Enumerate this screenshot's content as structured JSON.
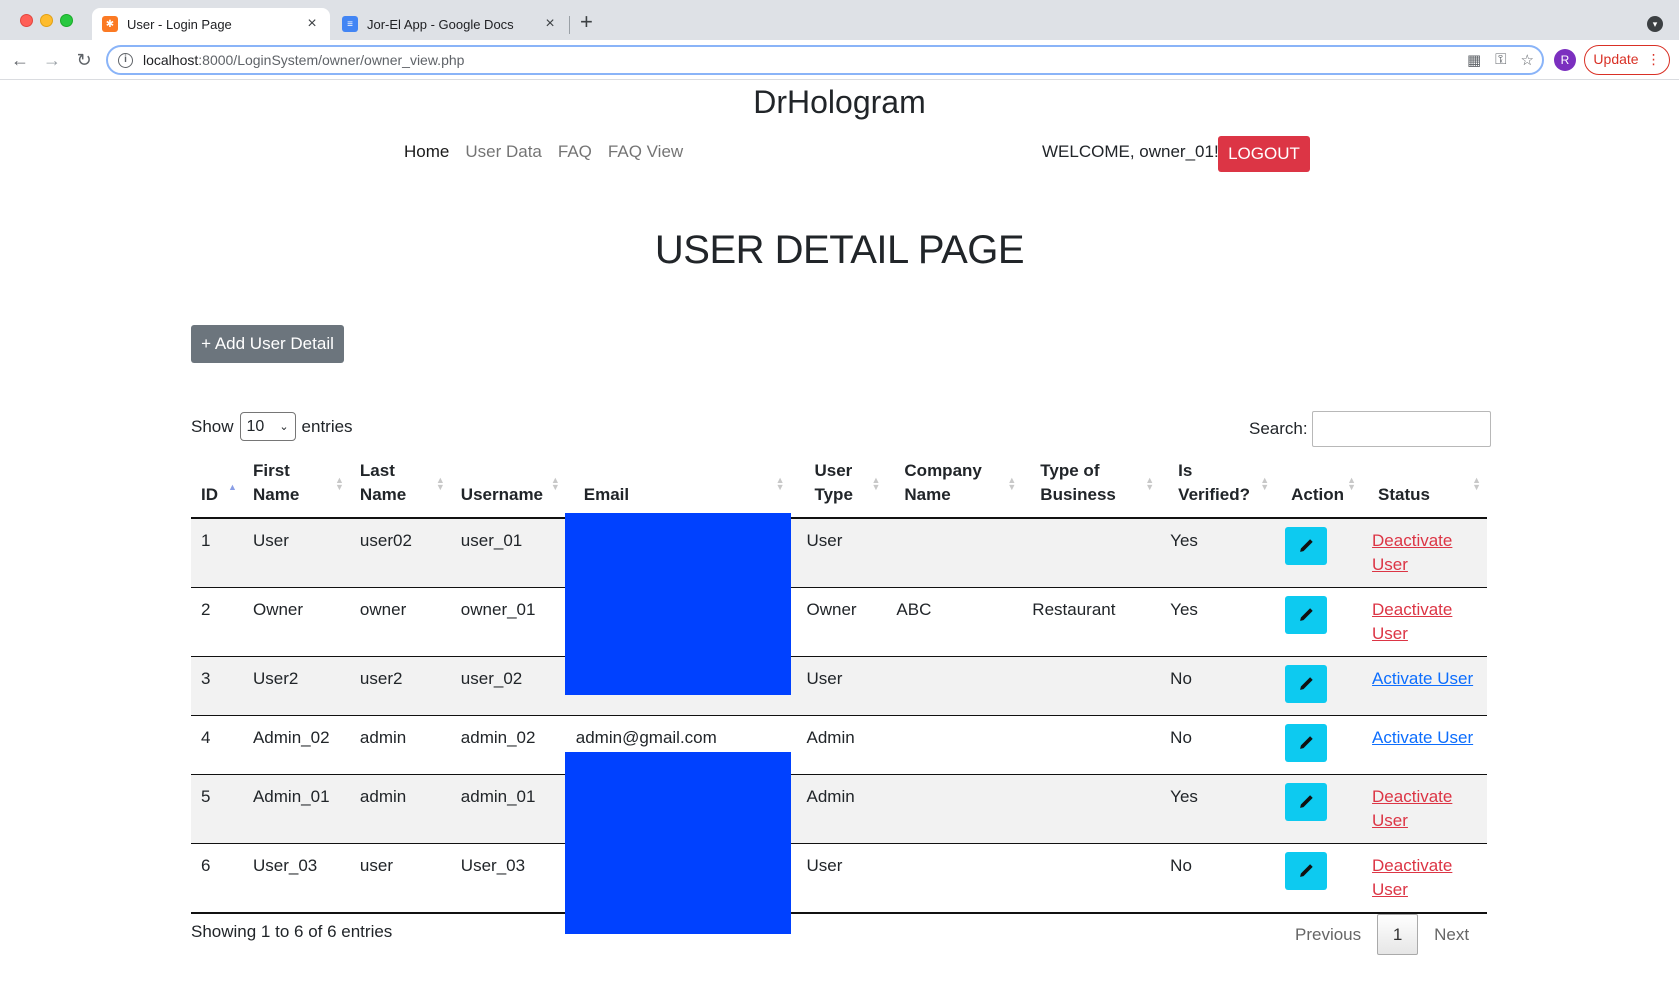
{
  "browser": {
    "tabs": [
      {
        "title": "User - Login Page",
        "active": true
      },
      {
        "title": "Jor-El App - Google Docs",
        "active": false
      }
    ],
    "new_tab_label": "+",
    "url_host": "localhost",
    "url_path": ":8000/LoginSystem/owner/owner_view.php",
    "profile_initial": "R",
    "update_label": "Update"
  },
  "site": {
    "brand": "DrHologram",
    "nav": [
      "Home",
      "User Data",
      "FAQ",
      "FAQ View"
    ],
    "welcome": "WELCOME, owner_01! -",
    "logout_label": "LOGOUT"
  },
  "page": {
    "heading": "USER DETAIL PAGE",
    "add_button": "+ Add User Detail"
  },
  "table_controls": {
    "show_label": "Show",
    "entries_value": "10",
    "entries_label": "entries",
    "search_label": "Search:",
    "search_value": ""
  },
  "table": {
    "headers": [
      "ID",
      "First Name",
      "Last Name",
      "Username",
      "Email",
      "User Type",
      "Company Name",
      "Type of Business",
      "Is Verified?",
      "Action",
      "Status"
    ],
    "sorted_column": "ID",
    "rows": [
      {
        "id": "1",
        "first": "User",
        "last": "user02",
        "username": "user_01",
        "email": "",
        "type": "User",
        "company": "",
        "business": "",
        "verified": "Yes",
        "status": "Deactivate User"
      },
      {
        "id": "2",
        "first": "Owner",
        "last": "owner",
        "username": "owner_01",
        "email": "",
        "type": "Owner",
        "company": "ABC",
        "business": "Restaurant",
        "verified": "Yes",
        "status": "Deactivate User"
      },
      {
        "id": "3",
        "first": "User2",
        "last": "user2",
        "username": "user_02",
        "email": "",
        "type": "User",
        "company": "",
        "business": "",
        "verified": "No",
        "status": "Activate User"
      },
      {
        "id": "4",
        "first": "Admin_02",
        "last": "admin",
        "username": "admin_02",
        "email": "admin@gmail.com",
        "type": "Admin",
        "company": "",
        "business": "",
        "verified": "No",
        "status": "Activate User"
      },
      {
        "id": "5",
        "first": "Admin_01",
        "last": "admin",
        "username": "admin_01",
        "email": "",
        "type": "Admin",
        "company": "",
        "business": "",
        "verified": "Yes",
        "status": "Deactivate User"
      },
      {
        "id": "6",
        "first": "User_03",
        "last": "user",
        "username": "User_03",
        "email": "",
        "type": "User",
        "company": "",
        "business": "",
        "verified": "No",
        "status": "Deactivate User"
      }
    ]
  },
  "footer": {
    "info": "Showing 1 to 6 of 6 entries",
    "prev": "Previous",
    "current_page": "1",
    "next": "Next"
  },
  "colors": {
    "logout": "#dc3545",
    "add_button": "#6c757d",
    "edit_button": "#0dcaf0",
    "deactivate_link": "#dc3545",
    "activate_link": "#0d6efd",
    "redaction": "#0041ff"
  },
  "icons": {
    "edit": "pencil-icon",
    "info": "info-icon",
    "star": "star-icon",
    "key": "key-icon"
  }
}
